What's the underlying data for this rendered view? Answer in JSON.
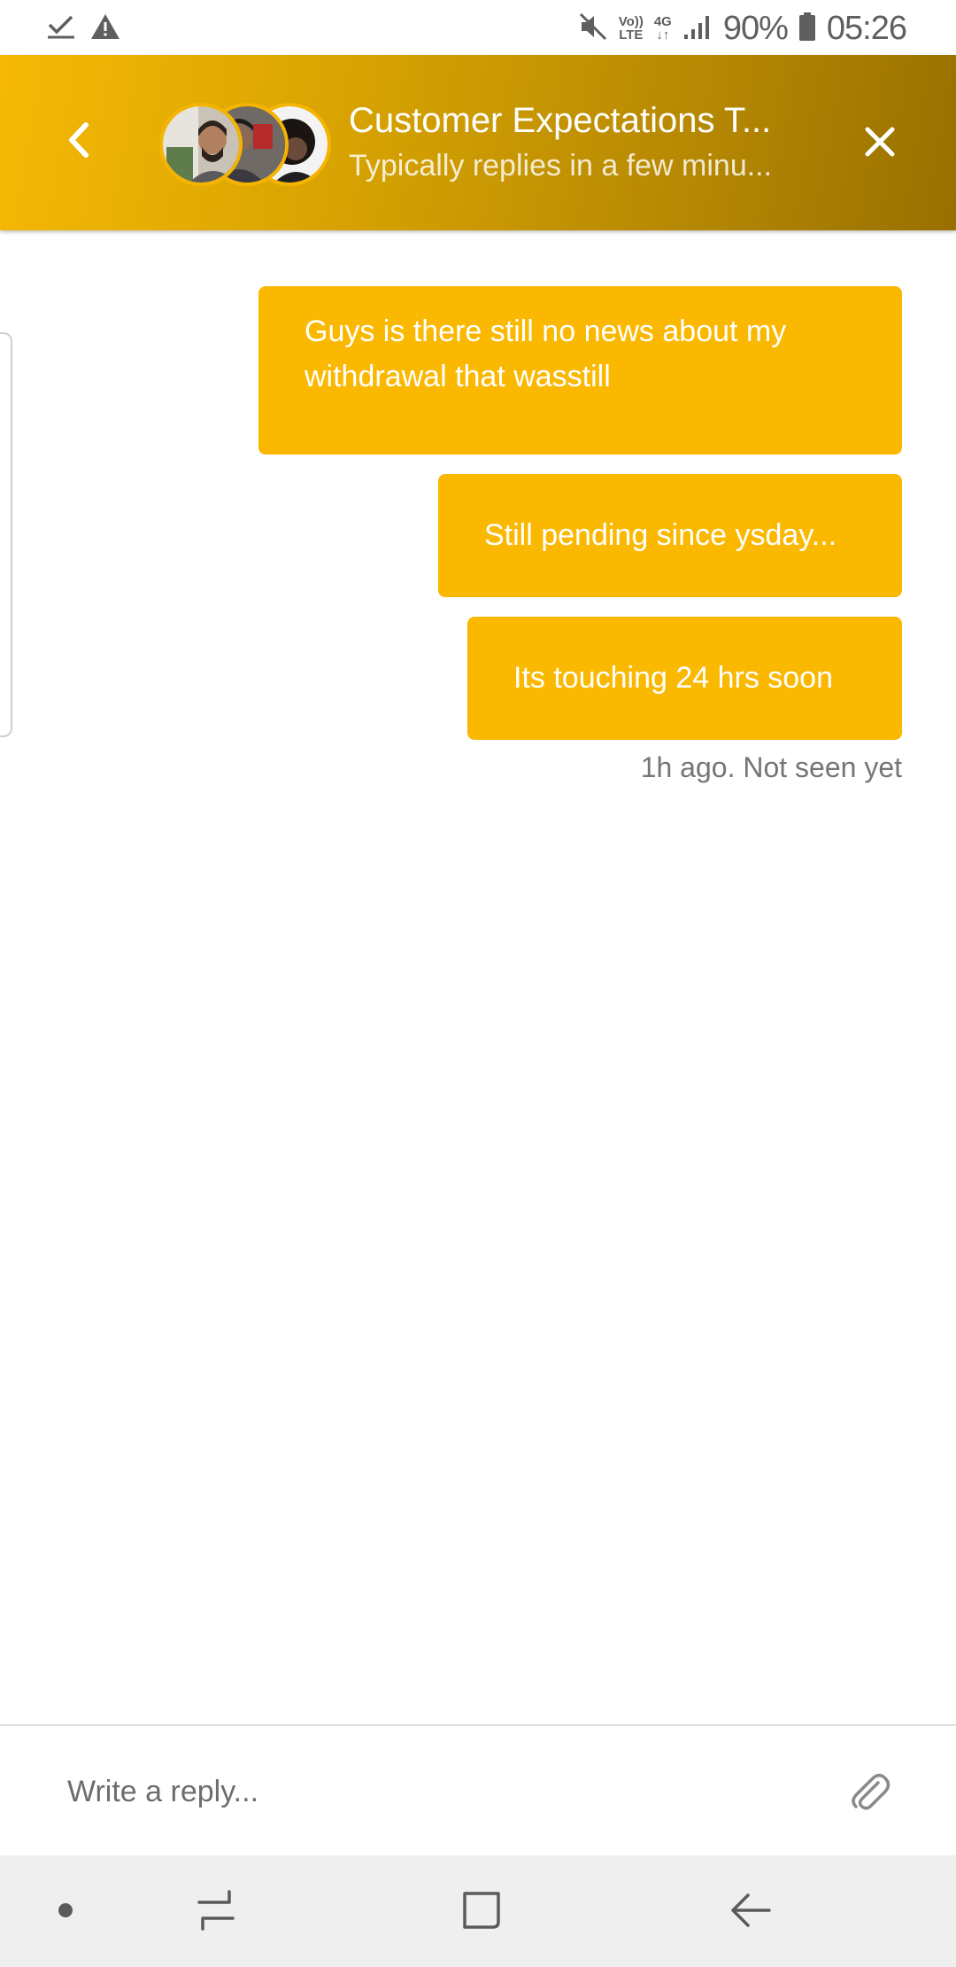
{
  "status_bar": {
    "notification_icons": [
      "check-icon",
      "warning-icon"
    ],
    "volte_top": "Vo))",
    "volte_bottom": "LTE",
    "network_top": "4G",
    "network_bottom": "↓↑",
    "battery_percent": "90%",
    "time": "05:26"
  },
  "header": {
    "title": "Customer Expectations T...",
    "subtitle": "Typically replies in a few minu...",
    "gradient_start": "#f5b805",
    "gradient_end": "#987000"
  },
  "messages": [
    {
      "text": "Guys is there still no news about my withdrawal that wasstill"
    },
    {
      "text": "Still pending since ysday..."
    },
    {
      "text": "Its touching 24 hrs soon"
    }
  ],
  "message_status": "1h ago. Not seen yet",
  "composer": {
    "placeholder": "Write a reply...",
    "value": ""
  },
  "colors": {
    "bubble": "#fbb800",
    "bubble_text": "#ffffff",
    "accent_border": "#f4b400"
  },
  "nav_bar": {
    "items": [
      "dot-icon",
      "recent-apps-icon",
      "home-icon",
      "back-icon"
    ]
  }
}
